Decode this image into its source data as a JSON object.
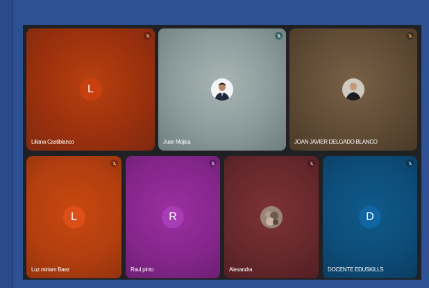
{
  "participants": [
    {
      "name": "Liliana Castiblanco",
      "initial": "L",
      "bg": "#a5330f",
      "avatar_bg": "#c9400f",
      "type": "initial"
    },
    {
      "name": "Juan Mojica",
      "initial": "",
      "bg": "#8a9a9a",
      "type": "photo",
      "photo": "person-in-suit"
    },
    {
      "name": "JOAN JAVIER DELGADO BLANCO",
      "initial": "",
      "bg": "#6a5238",
      "type": "photo",
      "photo": "person-dark-shirt"
    },
    {
      "name": "Luz miriam Baez",
      "initial": "L",
      "bg": "#b9420f",
      "avatar_bg": "#d64d18",
      "type": "initial"
    },
    {
      "name": "Raul pinto",
      "initial": "R",
      "bg": "#8a2a8f",
      "avatar_bg": "#a33cb0",
      "type": "initial"
    },
    {
      "name": "Alexandra",
      "initial": "",
      "bg": "#6f2a2e",
      "type": "photo",
      "photo": "small-photo"
    },
    {
      "name": "DOCENTE EDUSKILLS",
      "initial": "D",
      "bg": "#0d4f7d",
      "avatar_bg": "#0f5f98",
      "type": "initial"
    }
  ],
  "icons": {
    "mic": "mic-off-icon"
  }
}
